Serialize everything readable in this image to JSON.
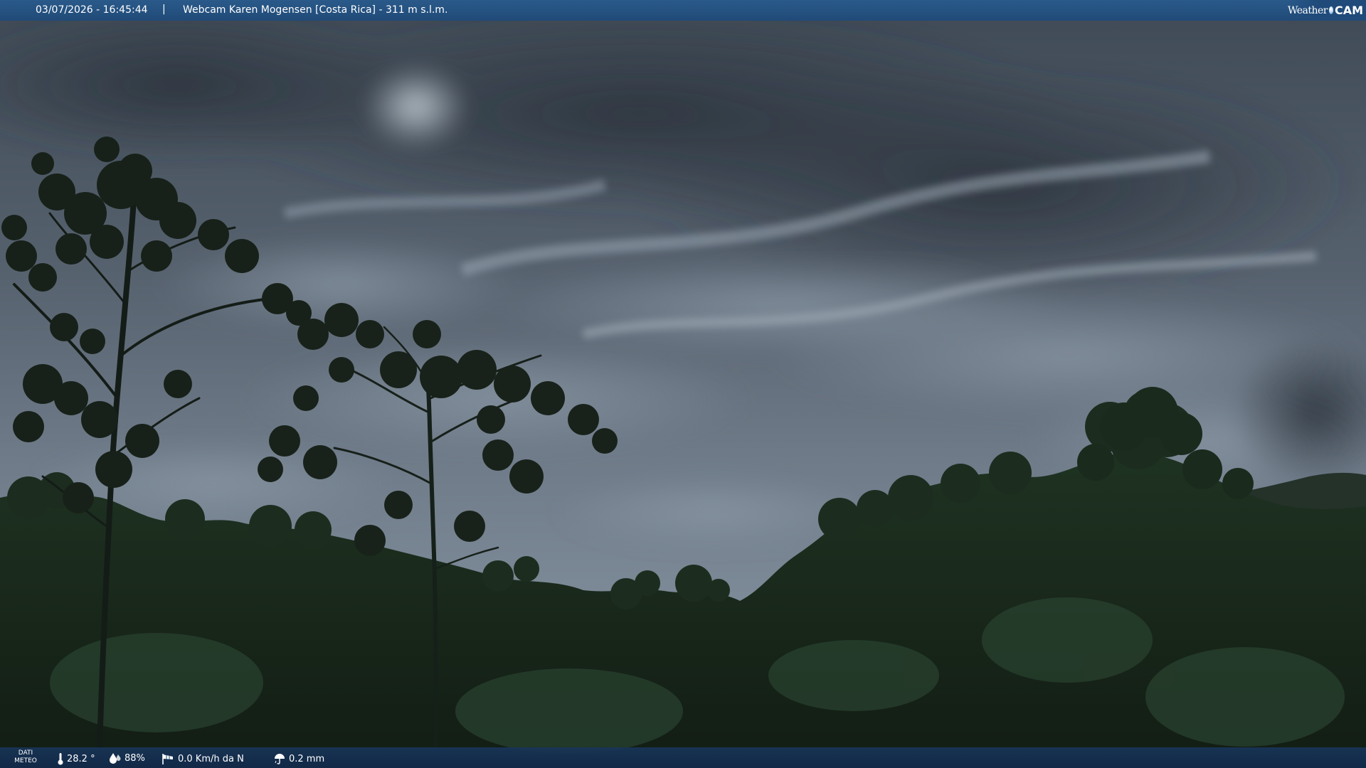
{
  "header": {
    "datetime": "03/07/2026 - 16:45:44",
    "separator": "|",
    "title": "Webcam Karen Mogensen [Costa Rica] - 311 m s.l.m."
  },
  "logo": {
    "text_weather": "Weather",
    "text_cam": "CAM"
  },
  "weather_data": {
    "label_line1": "DATI",
    "label_line2": "METEO",
    "temperature": "28.2 °",
    "humidity": "88%",
    "wind": "0.0 Km/h da N",
    "rain": "0.2 mm"
  },
  "colors": {
    "bar": "#204a78",
    "sky": "#5d6b7a",
    "forest": "#1a2a1c"
  }
}
